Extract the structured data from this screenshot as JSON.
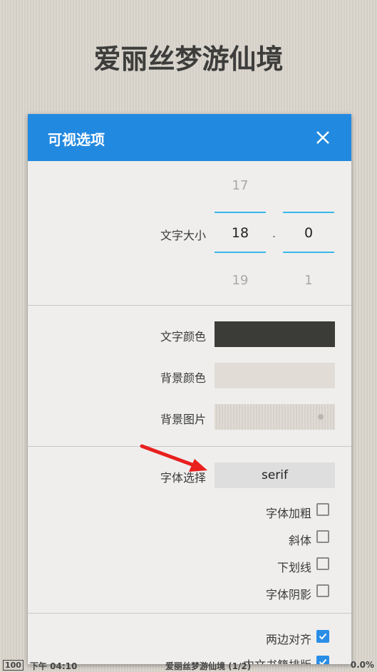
{
  "book": {
    "title": "爱丽丝梦游仙境"
  },
  "dialog": {
    "title": "可视选项",
    "font_size": {
      "label": "文字大小",
      "integer": {
        "prev": "17",
        "value": "18",
        "next": "19"
      },
      "separator": ".",
      "decimal": {
        "prev": "",
        "value": "0",
        "next": "1"
      }
    },
    "text_color": {
      "label": "文字颜色",
      "color": "#3b3b38"
    },
    "bg_color": {
      "label": "背景颜色",
      "color": "#e1ddd6"
    },
    "bg_image": {
      "label": "背景图片"
    },
    "font_select": {
      "label": "字体选择",
      "value": "serif"
    },
    "checkboxes": [
      {
        "label": "字体加粗",
        "checked": false
      },
      {
        "label": "斜体",
        "checked": false
      },
      {
        "label": "下划线",
        "checked": false
      },
      {
        "label": "字体阴影",
        "checked": false
      },
      {
        "label": "两边对齐",
        "checked": true
      },
      {
        "label": "中文书籍排版",
        "checked": true
      }
    ]
  },
  "status_bar": {
    "battery": "100",
    "time": "下午 04:10",
    "page_title": "爱丽丝梦游仙境 (1/2)",
    "progress": "0.0%"
  },
  "colors": {
    "accent": "#2289e0",
    "picker_line": "#38b8e8",
    "annotation_arrow": "#e8201e"
  }
}
